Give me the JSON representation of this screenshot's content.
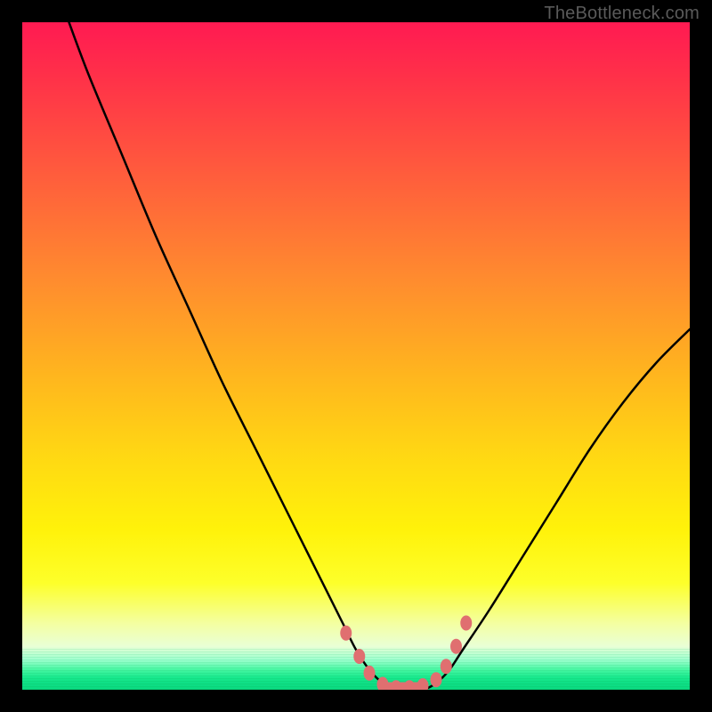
{
  "watermark": {
    "text": "TheBottleneck.com"
  },
  "colors": {
    "frame": "#000000",
    "curve_stroke": "#000000",
    "marker_fill": "#e06f70",
    "marker_stroke": "#c95d5e"
  },
  "chart_data": {
    "type": "line",
    "title": "",
    "xlabel": "",
    "ylabel": "",
    "xlim": [
      0,
      100
    ],
    "ylim": [
      0,
      100
    ],
    "grid": false,
    "legend": false,
    "note": "Axes unlabeled; values inferred as 0–100% horizontal position vs 0–100% bottleneck/mismatch. Minimum (~0) occurs near x≈54–62.",
    "series": [
      {
        "name": "bottleneck-curve",
        "x": [
          7,
          10,
          15,
          20,
          25,
          30,
          35,
          40,
          44,
          48,
          50,
          52,
          54,
          56,
          58,
          60,
          62,
          64,
          66,
          70,
          75,
          80,
          85,
          90,
          95,
          100
        ],
        "values": [
          100,
          92,
          80,
          68,
          57,
          46,
          36,
          26,
          18,
          10,
          6,
          3,
          1,
          0,
          0,
          0,
          1,
          3,
          6,
          12,
          20,
          28,
          36,
          43,
          49,
          54
        ]
      }
    ],
    "markers": [
      {
        "x": 48.5,
        "y": 8.5
      },
      {
        "x": 50.5,
        "y": 5.0
      },
      {
        "x": 52.0,
        "y": 2.5
      },
      {
        "x": 54.0,
        "y": 0.8
      },
      {
        "x": 56.0,
        "y": 0.3
      },
      {
        "x": 58.0,
        "y": 0.3
      },
      {
        "x": 60.0,
        "y": 0.6
      },
      {
        "x": 62.0,
        "y": 1.5
      },
      {
        "x": 63.5,
        "y": 3.5
      },
      {
        "x": 65.0,
        "y": 6.5
      },
      {
        "x": 66.5,
        "y": 10.0
      }
    ],
    "flat_segment": {
      "x_start": 54,
      "x_end": 60,
      "y": 0.4
    }
  }
}
